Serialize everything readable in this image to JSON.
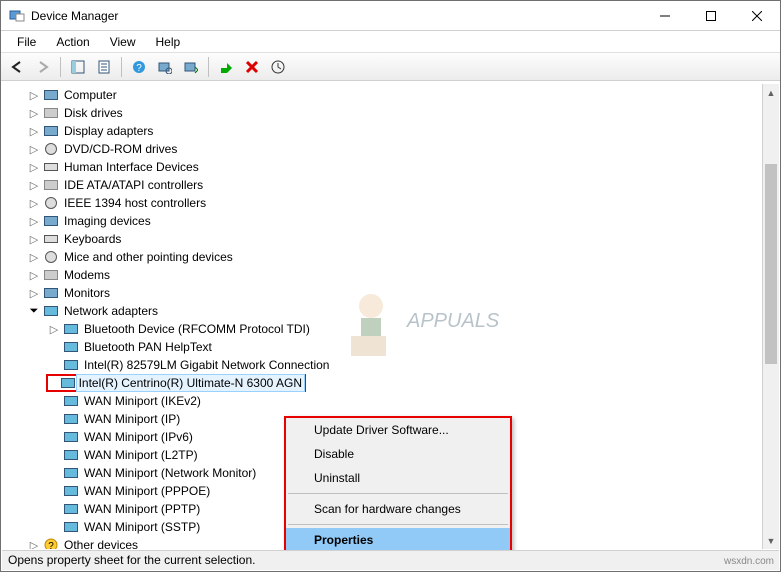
{
  "window": {
    "title": "Device Manager"
  },
  "menubar": [
    "File",
    "Action",
    "View",
    "Help"
  ],
  "tree": [
    "Computer",
    "Disk drives",
    "Display adapters",
    "DVD/CD-ROM drives",
    "Human Interface Devices",
    "IDE ATA/ATAPI controllers",
    "IEEE 1394 host controllers",
    "Imaging devices",
    "Keyboards",
    "Mice and other pointing devices",
    "Modems",
    "Monitors",
    "Network adapters",
    "Other devices"
  ],
  "adapters": [
    "Bluetooth Device (RFCOMM Protocol TDI)",
    "Bluetooth PAN HelpText",
    "Intel(R) 82579LM Gigabit Network Connection",
    "Intel(R) Centrino(R) Ultimate-N 6300 AGN",
    "WAN Miniport (IKEv2)",
    "WAN Miniport (IP)",
    "WAN Miniport (IPv6)",
    "WAN Miniport (L2TP)",
    "WAN Miniport (Network Monitor)",
    "WAN Miniport (PPPOE)",
    "WAN Miniport (PPTP)",
    "WAN Miniport (SSTP)"
  ],
  "context_menu": [
    "Update Driver Software...",
    "Disable",
    "Uninstall",
    "Scan for hardware changes",
    "Properties"
  ],
  "context_menu_highlighted_index": 4,
  "selected_device": "Intel(R) Centrino(R) Ultimate-N 6300 AGN",
  "status": "Opens property sheet for the current selection.",
  "watermark": {
    "text": "APPUALS"
  },
  "credit": "wsxdn.com",
  "annotations": {
    "red_highlight_boxes": [
      "selected-tree-item",
      "context-menu"
    ]
  }
}
